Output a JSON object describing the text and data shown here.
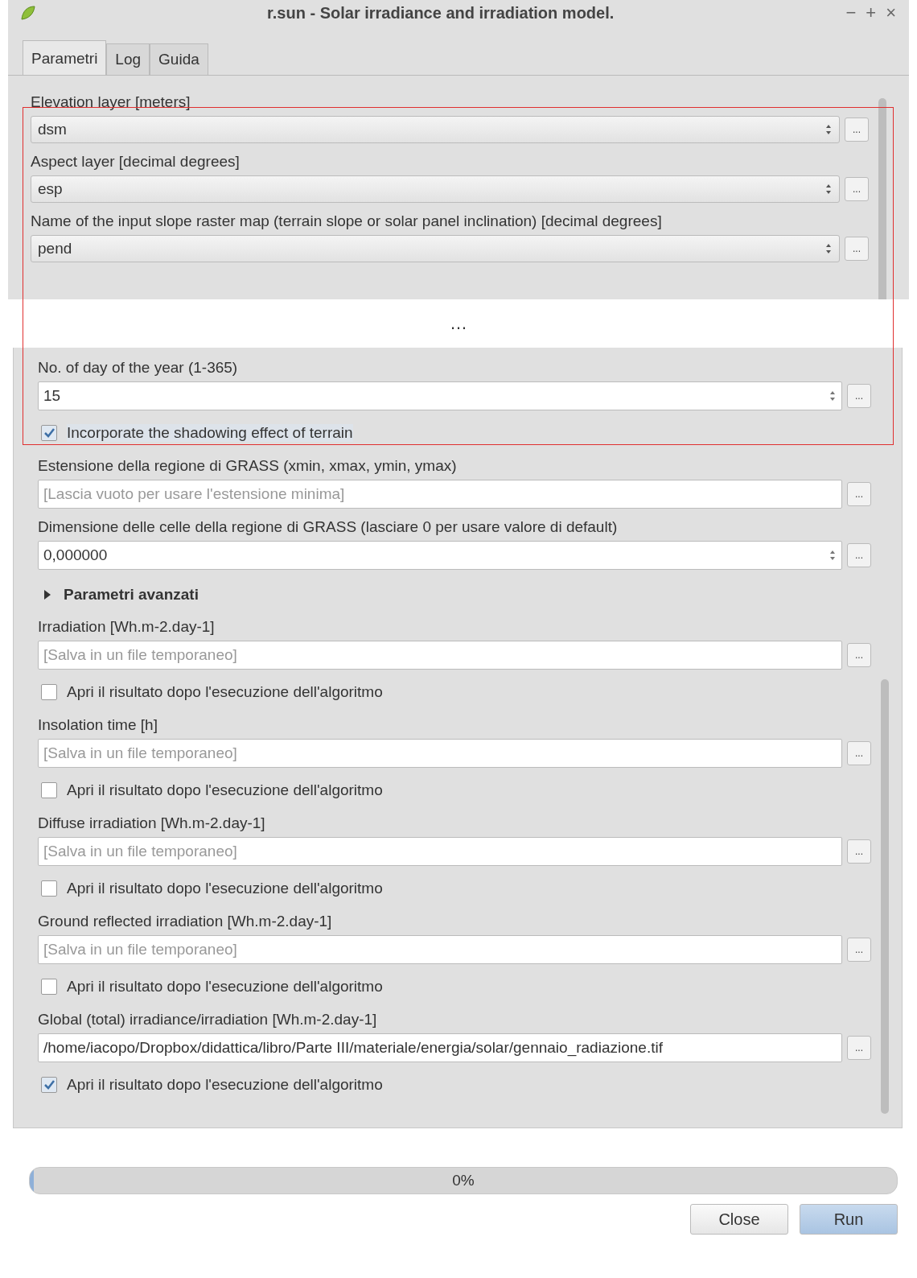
{
  "window": {
    "title": "r.sun - Solar irradiance and irradiation model.",
    "controls": [
      "−",
      "+",
      "×"
    ]
  },
  "tabs": [
    {
      "label": "Parametri",
      "selected": true
    },
    {
      "label": "Log",
      "selected": false
    },
    {
      "label": "Guida",
      "selected": false
    }
  ],
  "top_fields": [
    {
      "label": "Elevation layer [meters]",
      "value": "dsm"
    },
    {
      "label": "Aspect layer [decimal degrees]",
      "value": "esp"
    },
    {
      "label": "Name of the input slope raster map (terrain slope or solar panel inclination) [decimal degrees]",
      "value": "pend"
    }
  ],
  "break_mark": "…",
  "items": [
    {
      "kind": "spin",
      "label": "No. of day of the year (1-365)",
      "value": "15"
    },
    {
      "kind": "checkbox",
      "label": "Incorporate the shadowing effect of terrain",
      "checked": true
    },
    {
      "kind": "text",
      "label": "Estensione della regione di GRASS (xmin, xmax, ymin, ymax)",
      "placeholder": "[Lascia vuoto per usare l'estensione minima]"
    },
    {
      "kind": "spin",
      "label": "Dimensione delle celle della regione di GRASS (lasciare 0 per usare valore di default)",
      "value": "0,000000"
    },
    {
      "kind": "section",
      "label": "Parametri avanzati",
      "expanded": false
    },
    {
      "kind": "output",
      "label": "Irradiation [Wh.m-2.day-1]",
      "placeholder": "[Salva in un file temporaneo]",
      "open_label": "Apri il risultato dopo l'esecuzione dell'algoritmo",
      "checked": false
    },
    {
      "kind": "output",
      "label": "Insolation time [h]",
      "placeholder": "[Salva in un file temporaneo]",
      "open_label": "Apri il risultato dopo l'esecuzione dell'algoritmo",
      "checked": false
    },
    {
      "kind": "output",
      "label": "Diffuse irradiation [Wh.m-2.day-1]",
      "placeholder": "[Salva in un file temporaneo]",
      "open_label": "Apri il risultato dopo l'esecuzione dell'algoritmo",
      "checked": false
    },
    {
      "kind": "output",
      "label": "Ground reflected irradiation [Wh.m-2.day-1]",
      "placeholder": "[Salva in un file temporaneo]",
      "open_label": "Apri il risultato dopo l'esecuzione dell'algoritmo",
      "checked": false
    },
    {
      "kind": "output",
      "label": "Global (total) irradiance/irradiation [Wh.m-2.day-1]",
      "value": "/home/iacopo/Dropbox/didattica/libro/Parte III/materiale/energia/solar/gennaio_radiazione.tif",
      "open_label": "Apri il risultato dopo l'esecuzione dell'algoritmo",
      "checked": true
    }
  ],
  "more_button": "...",
  "progress": {
    "level": 0,
    "text": "0%"
  },
  "buttons": [
    {
      "label": "Close",
      "kind": "default"
    },
    {
      "label": "Run",
      "kind": "primary"
    }
  ]
}
